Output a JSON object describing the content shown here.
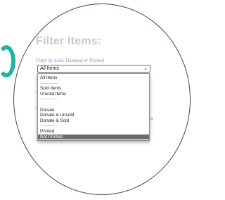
{
  "panel": {
    "title": "Filter Items:",
    "filter_label": "Filter by Sold, Donated or Printed",
    "selected_value": "All Items"
  },
  "dropdown": {
    "options": [
      "All Items",
      "--------------",
      "Sold Items",
      "Unsold Items",
      "--------------",
      "",
      "Donate",
      "Donate & Unsold",
      "Donate & Sold",
      "--------------",
      "Printed",
      "Not Printed"
    ],
    "highlighted": "Not Printed"
  },
  "colors": {
    "frame": "#4e3a5e",
    "accent_glyph": "#20b3a1",
    "label": "#8f84cf",
    "highlight": "#6b6b6b"
  }
}
